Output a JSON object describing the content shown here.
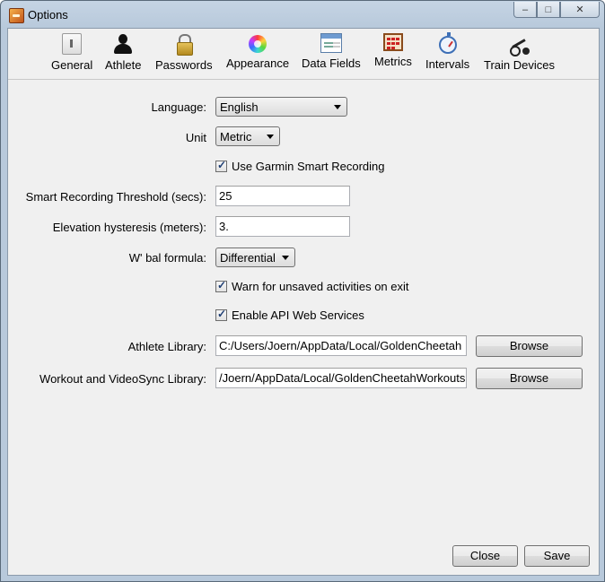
{
  "window": {
    "title": "Options"
  },
  "toolbar": {
    "items": [
      {
        "label": "General",
        "icon": "general-icon"
      },
      {
        "label": "Athlete",
        "icon": "athlete-icon"
      },
      {
        "label": "Passwords",
        "icon": "lock-icon"
      },
      {
        "label": "Appearance",
        "icon": "color-wheel-icon"
      },
      {
        "label": "Data Fields",
        "icon": "data-fields-icon"
      },
      {
        "label": "Metrics",
        "icon": "abacus-icon"
      },
      {
        "label": "Intervals",
        "icon": "stopwatch-icon"
      },
      {
        "label": "Train Devices",
        "icon": "bike-icon"
      }
    ]
  },
  "form": {
    "language": {
      "label": "Language:",
      "value": "English"
    },
    "unit": {
      "label": "Unit",
      "value": "Metric"
    },
    "garmin_smart_recording": {
      "label": "Use Garmin Smart Recording",
      "checked": true
    },
    "smart_recording_threshold": {
      "label": "Smart Recording Threshold (secs):",
      "value": "25"
    },
    "elevation_hysteresis": {
      "label": "Elevation hysteresis (meters):",
      "value": "3."
    },
    "wbal_formula": {
      "label": "W' bal formula:",
      "value": "Differential"
    },
    "warn_unsaved": {
      "label": "Warn for unsaved activities on exit",
      "checked": true
    },
    "enable_api": {
      "label": "Enable API Web Services",
      "checked": true
    },
    "athlete_library": {
      "label": "Athlete Library:",
      "value": "C:/Users/Joern/AppData/Local/GoldenCheetah",
      "button": "Browse"
    },
    "workout_library": {
      "label": "Workout and VideoSync Library:",
      "value": "/Joern/AppData/Local/GoldenCheetahWorkouts",
      "button": "Browse"
    }
  },
  "footer": {
    "close_label": "Close",
    "save_label": "Save"
  }
}
